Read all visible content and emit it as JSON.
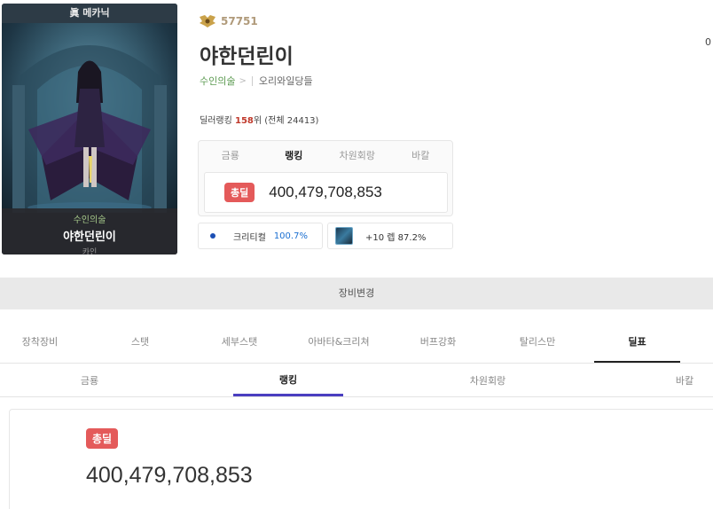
{
  "card": {
    "header": "眞 메카닉",
    "job": "수인의술",
    "name": "야한던린이",
    "server": "카인"
  },
  "profile": {
    "fame_icon": "fame-wings-icon",
    "fame": "57751",
    "name": "야한던린이",
    "job": "수인의술",
    "guild": "오리와일당들",
    "rank_prefix": "딜러랭킹",
    "rank_num": "158",
    "rank_suffix": "위 (전체 24413)"
  },
  "stat_box": {
    "tabs": [
      "금룡",
      "랭킹",
      "차원회랑",
      "바칼"
    ],
    "active_tab": 1,
    "badge": "총딜",
    "value": "400,479,708,853"
  },
  "crit": {
    "label": "크리티컬",
    "value": "100.7%"
  },
  "item": {
    "icon": "item-thumbnail-icon",
    "label": "+10 렙 87.2%"
  },
  "corner_value": "0",
  "equip_bar": {
    "label": "장비변경"
  },
  "main_nav": {
    "items": [
      "장착장비",
      "스탯",
      "세부스탯",
      "아바타&크리쳐",
      "버프강화",
      "탈리스만",
      "딜표"
    ],
    "active": 6
  },
  "sub_nav": {
    "items": [
      "금룡",
      "랭킹",
      "차원회랑",
      "바칼"
    ],
    "active": 1
  },
  "result": {
    "badge": "총딜",
    "value": "400,479,708,853"
  },
  "colors": {
    "accent": "#4a3ec0",
    "badge": "#e45a5a",
    "crit": "#1b6fd1",
    "job": "#5b9a50"
  }
}
